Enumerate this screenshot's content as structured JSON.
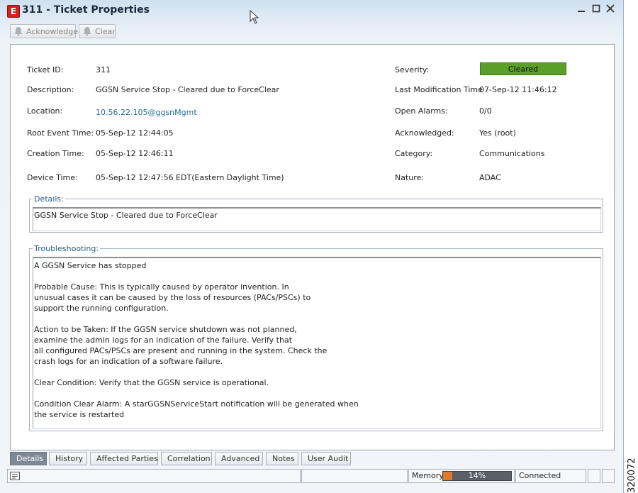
{
  "window": {
    "title": "311 - Ticket Properties",
    "logo_letter": "E",
    "controls": [
      "minimize",
      "maximize",
      "close"
    ]
  },
  "toolbar": {
    "acknowledge_label": "Acknowledge",
    "clear_label": "Clear"
  },
  "fields": {
    "ticket_id_label": "Ticket ID:",
    "ticket_id": "311",
    "description_label": "Description:",
    "description": "GGSN Service Stop - Cleared due to ForceClear",
    "location_label": "Location:",
    "location": "10.56.22.105@ggsnMgmt",
    "root_event_time_label": "Root Event Time:",
    "root_event_time": "05-Sep-12 12:44:05",
    "creation_time_label": "Creation Time:",
    "creation_time": "05-Sep-12 12:46:11",
    "device_time_label": "Device Time:",
    "device_time": "05-Sep-12 12:47:56 EDT(Eastern Daylight Time)",
    "severity_label": "Severity:",
    "severity": "Cleared",
    "severity_color": "#5b9e28",
    "last_mod_label": "Last Modification Time",
    "last_mod": "07-Sep-12 11:46:12",
    "open_alarms_label": "Open Alarms:",
    "open_alarms": "0/0",
    "acknowledged_label": "Acknowledged:",
    "acknowledged": "Yes (root)",
    "category_label": "Category:",
    "category": "Communications",
    "nature_label": "Nature:",
    "nature": "ADAC"
  },
  "details": {
    "title": "Details:",
    "text": "GGSN Service Stop - Cleared due to ForceClear"
  },
  "troubleshooting": {
    "title": "Troubleshooting:",
    "text": "A GGSN Service has stopped\n\nProbable Cause: This is typically caused by operator invention. In\nunusual cases it can be caused by the loss of resources (PACs/PSCs) to\nsupport the running configuration.\n\nAction to be Taken: If the GGSN service shutdown was not planned,\nexamine the admin logs for an indication of the failure. Verify that\nall configured PACs/PSCs are present and running in the system. Check the\ncrash logs for an indication of a software failure.\n\nClear Condition: Verify that the GGSN service is operational.\n\nCondition Clear Alarm: A starGGSNServiceStart notification will be generated when\nthe service is restarted"
  },
  "tabs": [
    {
      "label": "Details",
      "active": true
    },
    {
      "label": "History",
      "active": false
    },
    {
      "label": "Affected Parties",
      "active": false
    },
    {
      "label": "Correlation",
      "active": false
    },
    {
      "label": "Advanced",
      "active": false
    },
    {
      "label": "Notes",
      "active": false
    },
    {
      "label": "User Audit",
      "active": false
    }
  ],
  "status": {
    "memory_label": "Memory:",
    "memory_text": "14%",
    "memory_fraction": 0.14,
    "connection": "Connected"
  },
  "figure_id": "320072"
}
